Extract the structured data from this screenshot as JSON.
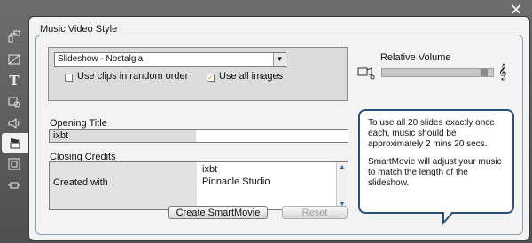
{
  "window": {
    "close_icon": "close-icon"
  },
  "toolbar": {
    "items": [
      {
        "name": "theme-tool-icon"
      },
      {
        "name": "transitions-tool-icon"
      },
      {
        "name": "titles-tool-icon"
      },
      {
        "name": "effects-tool-icon"
      },
      {
        "name": "audio-tool-icon"
      },
      {
        "name": "smartmovie-tool-icon",
        "active": true
      },
      {
        "name": "disc-tool-icon"
      },
      {
        "name": "export-tool-icon"
      }
    ]
  },
  "music_video": {
    "section_title": "Music Video Style",
    "style_select_value": "Slideshow - Nostalgia",
    "random_order_label": "Use clips in random order",
    "random_order_checked": false,
    "all_images_label": "Use all images",
    "all_images_checked": true,
    "relative_volume_label": "Relative Volume",
    "relative_volume_level": 0.95,
    "opening_title_label": "Opening Title",
    "opening_title_value": "ixbt",
    "closing_credits_label": "Closing Credits",
    "credits": {
      "role": "Created with",
      "names": [
        "ixbt",
        "Pinnacle Studio"
      ]
    },
    "create_button": "Create SmartMovie",
    "reset_button": "Reset"
  },
  "tip": {
    "paragraph1": "To use all 20 slides exactly once each, music should be approximately 2 mins 20 secs.",
    "paragraph2": "SmartMovie will adjust your music to match the length of the slideshow."
  },
  "colors": {
    "accent": "#2b4f7a",
    "background": "#5b5b5b",
    "panel": "#f3f3f3"
  }
}
